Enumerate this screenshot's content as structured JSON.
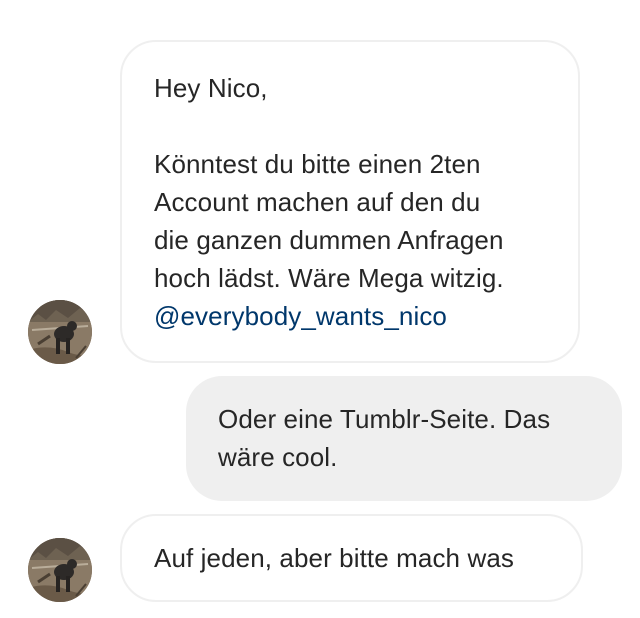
{
  "conversation": {
    "messages": [
      {
        "direction": "incoming",
        "greeting": "Hey Nico,",
        "lines": [
          "Könntest du bitte einen 2ten",
          "Account machen auf den du",
          "die ganzen dummen Anfragen",
          "hoch lädst. Wäre Mega witzig."
        ],
        "mention": "@everybody_wants_nico",
        "avatar": "dog-avatar-icon"
      },
      {
        "direction": "outgoing",
        "lines": [
          "Oder eine Tumblr-Seite. Das",
          "wäre cool."
        ]
      },
      {
        "direction": "incoming",
        "lines": [
          "Auf jeden, aber bitte mach was"
        ],
        "avatar": "dog-avatar-icon"
      }
    ]
  },
  "colors": {
    "incoming_border": "#efefef",
    "outgoing_background": "#efefef",
    "mention": "#00376b",
    "text": "#262626"
  }
}
